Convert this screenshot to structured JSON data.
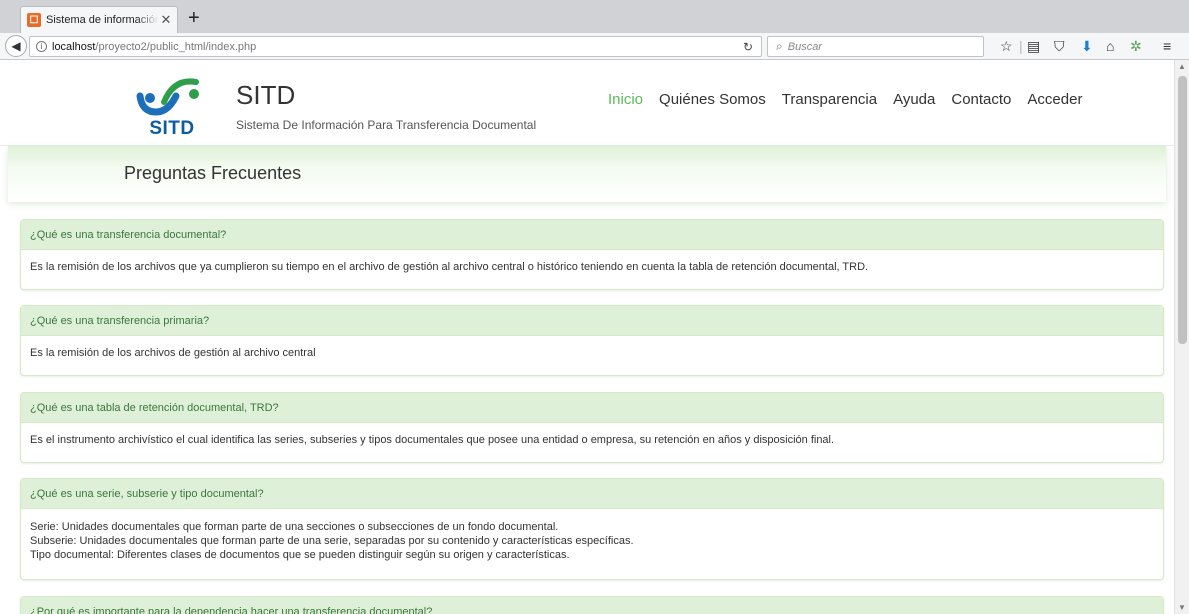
{
  "browser": {
    "tab_title": "Sistema de información par",
    "tab_close": "✕",
    "new_tab": "+",
    "url_host": "localhost",
    "url_path": "/proyecto2/public_html/index.php",
    "search_placeholder": "Buscar"
  },
  "site": {
    "logo_text": "SITD",
    "title": "SITD",
    "subtitle": "Sistema De Información Para Transferencia Documental",
    "menu": [
      "Inicio",
      "Quiénes Somos",
      "Transparencia",
      "Ayuda",
      "Contacto",
      "Acceder"
    ],
    "active_menu": "Inicio",
    "accent_color": "#5cb85c"
  },
  "banner": {
    "title": "Preguntas Frecuentes"
  },
  "faqs": [
    {
      "question": "¿Qué es una transferencia documental?",
      "answer": [
        "Es la remisión de los archivos que ya cumplieron su tiempo en el archivo de gestión al archivo central o histórico teniendo en cuenta la tabla de retención documental, TRD."
      ]
    },
    {
      "question": "¿Qué es una transferencia primaria?",
      "answer": [
        "Es la remisión de los archivos de gestión al archivo central"
      ]
    },
    {
      "question": "¿Qué es una tabla de retención documental, TRD?",
      "answer": [
        "Es el instrumento archivístico el cual identifica las series, subseries y tipos documentales que posee una entidad o empresa, su retención en años y disposición final."
      ]
    },
    {
      "question": "¿Qué es una serie, subserie y tipo documental?",
      "answer": [
        "Serie: Unidades documentales que forman parte de una secciones o subsecciones de un fondo documental.",
        "Subserie: Unidades documentales que forman parte de una serie, separadas por su contenido y características específicas.",
        "Tipo documental: Diferentes clases de documentos que se pueden distinguir según su origen y características."
      ]
    },
    {
      "question": "¿Por qué es importante para la dependencia hacer una transferencia documental?",
      "answer": []
    }
  ]
}
